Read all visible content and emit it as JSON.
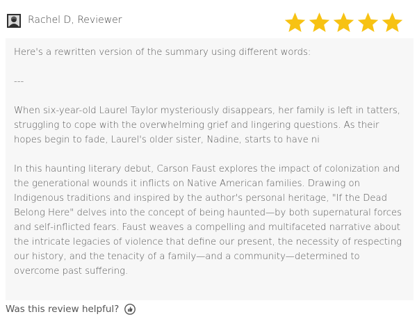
{
  "reviewer": {
    "name": "Rachel D, Reviewer",
    "avatar_icon": "reviewer-avatar"
  },
  "rating": {
    "stars": 5,
    "max": 5,
    "star_color": "#f7c213"
  },
  "review": {
    "paragraphs": [
      "Here's a rewritten version of the summary using different words:",
      "---",
      "When six-year-old Laurel Taylor mysteriously disappears, her family is left in tatters, struggling to cope with the overwhelming grief and lingering questions. As their hopes begin to fade, Laurel's older sister, Nadine, starts to have ni",
      "In this haunting literary debut, Carson Faust explores the impact of colonization and the generational wounds it inflicts on Native American families. Drawing on Indigenous traditions and inspired by the author's personal heritage, \"If the Dead Belong Here\" delves into the concept of being haunted—by both supernatural forces and self-inflicted fears. Faust weaves a compelling and multifaceted narrative about the intricate legacies of violence that define our present, the necessity of respecting our history, and the tenacity of a family—and a community—determined to overcome past suffering."
    ]
  },
  "footer": {
    "helpful_label": "Was this review helpful?",
    "icon": "thumbs-up-icon"
  }
}
